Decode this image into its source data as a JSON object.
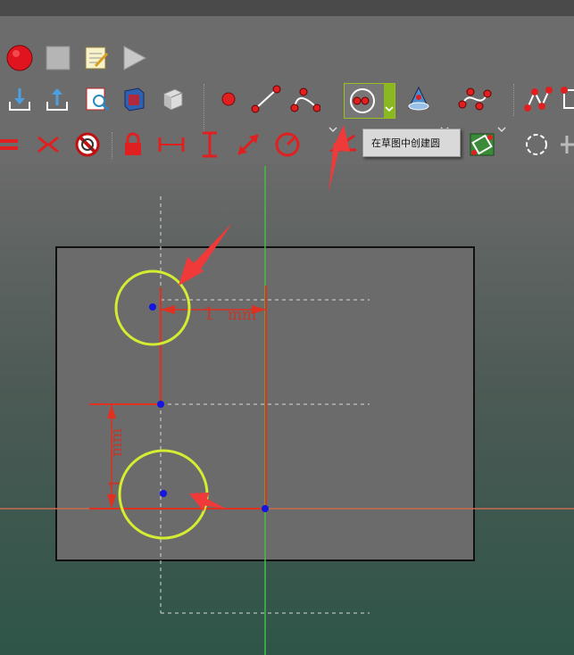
{
  "toolbar": {
    "row1": [
      "record-macro-icon",
      "stop-macro-icon",
      "macro-editor-icon",
      "execute-macro-icon"
    ],
    "row2": [
      "import-icon",
      "export-icon",
      "inspect-icon",
      "box-view-icon",
      "part-view-icon",
      "point-icon",
      "line-icon",
      "arc-icon",
      "circle-tool-icon",
      "conic-icon",
      "bspline-icon",
      "polyline-icon",
      "rectangle-icon"
    ],
    "row3": [
      "equal-constraint-icon",
      "symmetric-constraint-icon",
      "block-constraint-icon",
      "lock-constraint-icon",
      "horizontal-distance-icon",
      "vertical-distance-icon",
      "distance-icon",
      "radius-icon",
      "angle-icon",
      "external-geometry-icon",
      "carbon-copy-icon",
      "construction-toggle-icon"
    ]
  },
  "tooltip": {
    "text": "在草图中创建圆"
  },
  "sketch": {
    "dim_horizontal": {
      "value": "1",
      "unit": "mm"
    },
    "dim_vertical": {
      "value": "1",
      "unit": "mm"
    }
  },
  "colors": {
    "toolbar_bg": "#6c6c6c",
    "sketch_plane": "#6b6b6b",
    "circle": "#d4ec32",
    "constraint_red": "#e03020",
    "point_blue": "#1515e0",
    "axis_green": "#40c040",
    "axis_red": "#c86a50",
    "arrow_annotation": "#f03a3a"
  }
}
